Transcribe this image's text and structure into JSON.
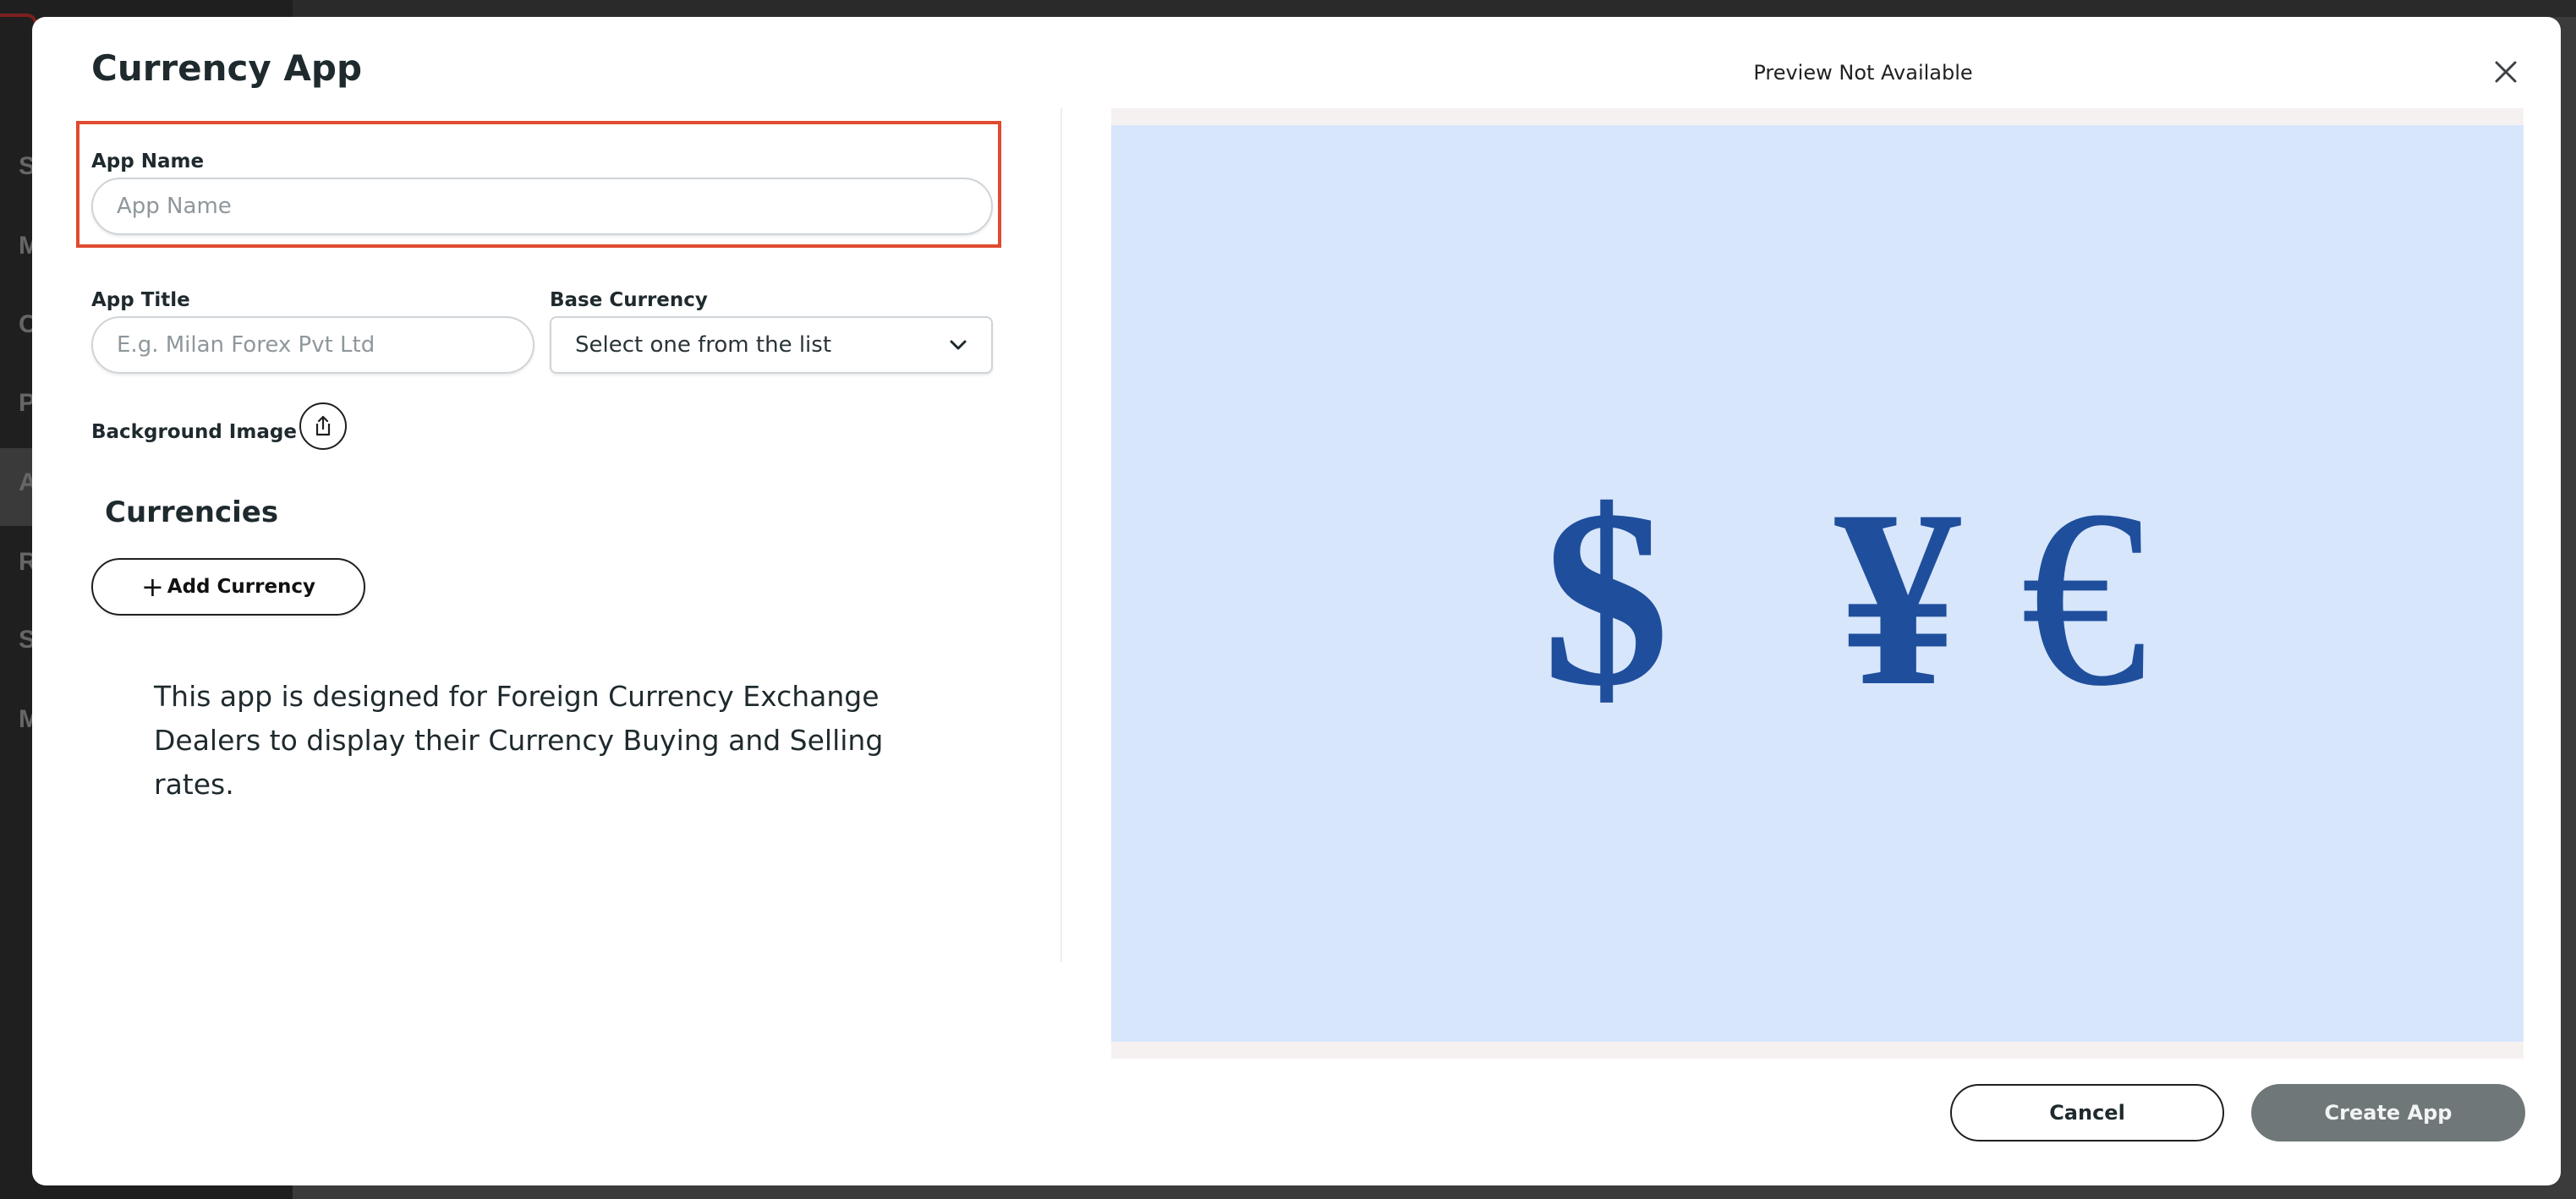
{
  "background": {
    "sidebar_letters": [
      "S",
      "M",
      "C",
      "P",
      "A",
      "R",
      "S",
      "M"
    ]
  },
  "modal": {
    "title": "Currency App",
    "preview_status": "Preview Not Available",
    "close_icon": "close-icon"
  },
  "form": {
    "app_name": {
      "label": "App Name",
      "placeholder": "App Name",
      "value": ""
    },
    "app_title": {
      "label": "App Title",
      "placeholder": "E.g. Milan Forex Pvt Ltd",
      "value": ""
    },
    "base_currency": {
      "label": "Base Currency",
      "selected": "Select one from the list",
      "icon": "chevron-down-icon"
    },
    "background_image": {
      "label": "Background Image",
      "icon": "upload-icon"
    },
    "currencies": {
      "title": "Currencies",
      "add_button_label": "Add Currency",
      "add_icon": "plus-icon"
    },
    "description": "This app is designed for Foreign Currency Exchange Dealers to display their Currency Buying and Selling rates."
  },
  "preview": {
    "symbols": [
      "$",
      "¥",
      "€"
    ],
    "background_color": "#d7e6fb",
    "symbol_color": "#1f4e9c"
  },
  "footer": {
    "cancel_label": "Cancel",
    "create_label": "Create App"
  },
  "colors": {
    "highlight_border": "#e04a2f",
    "create_button_bg": "#6f7778"
  }
}
